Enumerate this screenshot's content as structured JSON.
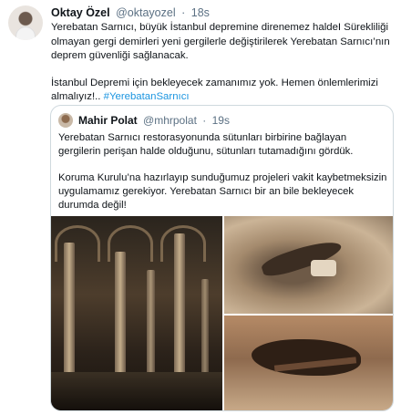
{
  "tweet": {
    "author_name": "Oktay Özel",
    "author_handle": "@oktayozel",
    "separator": "·",
    "time": "18s",
    "paragraph1": "Yerebatan Sarnıcı, büyük İstanbul depremine direnemez haldeI Sürekliliği olmayan gergi demirleri yeni gergilerle değiştirilerek Yerebatan Sarnıcı’nın deprem güvenliği sağlanacak.",
    "paragraph2_text": "İstanbul Depremi için bekleyecek zamanımız yok. Hemen önlemlerimizi almalıyız!.. ",
    "hashtag": "#YerebatanSarnıcı"
  },
  "quoted": {
    "author_name": "Mahir Polat",
    "author_handle": "@mhrpolat",
    "separator": "·",
    "time": "19s",
    "paragraph1": "Yerebatan Sarnıcı restorasyonunda sütunları birbirine bağlayan gergilerin perişan halde olduğunu, sütunları tutamadığını gördük.",
    "paragraph2": "Koruma Kurulu’na hazırlayıp sunduğumuz projeleri vakit kaybetmeksizin uygulamamız gerekiyor.  Yerebatan Sarnıcı bir an bile bekleyecek durumda değil!"
  },
  "media": {
    "images": [
      "cistern-columns-photo",
      "damaged-stone-photo",
      "corroded-tie-rod-photo"
    ]
  }
}
